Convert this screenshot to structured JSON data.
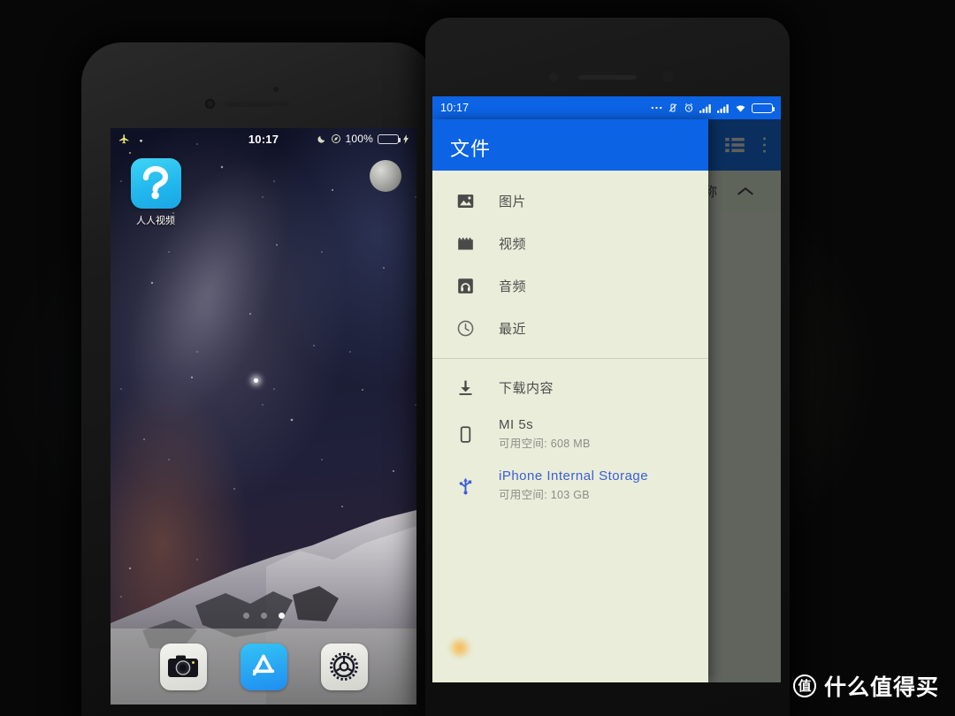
{
  "iphone": {
    "status_bar": {
      "airplane_icon": "airplane-icon",
      "wifi_icon": "wifi-icon",
      "time": "10:17",
      "dnd_icon": "moon-icon",
      "location_icon": "location-icon",
      "battery_percent": "100%",
      "battery_icon": "battery-full-icon",
      "charging_icon": "lightning-icon"
    },
    "apps": [
      {
        "label": "人人视频",
        "icon": "renren-video-icon"
      }
    ],
    "page_dots": {
      "count": 3,
      "active_index": 2
    },
    "dock": [
      {
        "label": "Camera",
        "icon": "camera-icon"
      },
      {
        "label": "App Store",
        "icon": "app-store-icon"
      },
      {
        "label": "Settings",
        "icon": "settings-gear-icon"
      }
    ]
  },
  "android": {
    "status_bar": {
      "time": "10:17",
      "icons": [
        "more-dots-icon",
        "vibrate-off-icon",
        "alarm-icon",
        "signal-1-icon",
        "signal-2-icon",
        "wifi-icon",
        "battery-icon"
      ]
    },
    "app_bar": {
      "title": "文件",
      "list_view_icon": "list-view-icon",
      "overflow_icon": "overflow-menu-icon"
    },
    "sort_bar": {
      "label": "称",
      "chevron_icon": "chevron-up-icon"
    },
    "drawer": {
      "title": "文件",
      "items": [
        {
          "label": "图片",
          "icon": "image-icon",
          "sub": ""
        },
        {
          "label": "视频",
          "icon": "video-icon",
          "sub": ""
        },
        {
          "label": "音频",
          "icon": "audio-icon",
          "sub": ""
        },
        {
          "label": "最近",
          "icon": "clock-icon",
          "sub": ""
        }
      ],
      "storage_items": [
        {
          "label": "下载内容",
          "icon": "download-icon",
          "sub": "",
          "highlight": false
        },
        {
          "label": "MI 5s",
          "icon": "phone-icon",
          "sub": "可用空间: 608 MB",
          "highlight": false
        },
        {
          "label": "iPhone Internal Storage",
          "icon": "usb-icon",
          "sub": "可用空间: 103 GB",
          "highlight": true
        }
      ]
    }
  },
  "watermark": {
    "badge": "值",
    "text": "什么值得买"
  },
  "colors": {
    "android_blue": "#0c63e4",
    "drawer_bg": "#e9edd9",
    "link_blue": "#3b5ed8",
    "battery_green": "#35d43a",
    "battery_orange": "#f0a22a"
  }
}
